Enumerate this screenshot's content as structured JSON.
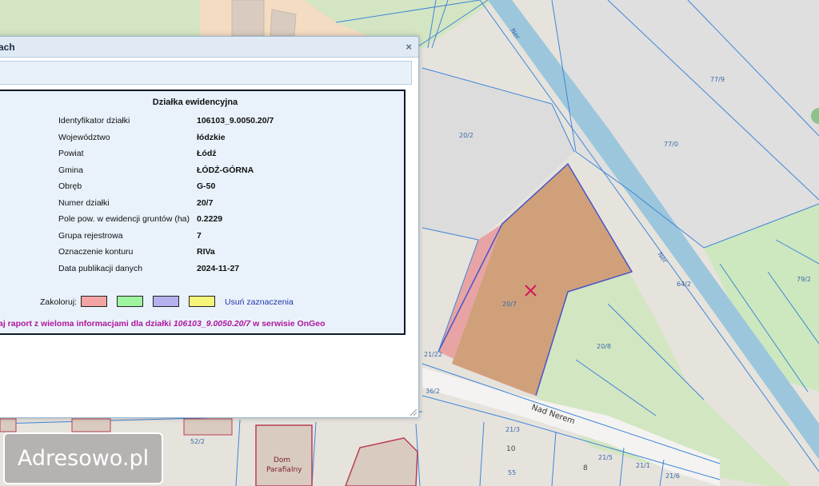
{
  "popup": {
    "title": "ach",
    "close_label": "×",
    "info": {
      "heading": "Działka ewidencyjna",
      "rows": [
        {
          "label": "Identyfikator działki",
          "value": "106103_9.0050.20/7"
        },
        {
          "label": "Województwo",
          "value": "łódzkie"
        },
        {
          "label": "Powiat",
          "value": "Łódź"
        },
        {
          "label": "Gmina",
          "value": "ŁÓDŹ-GÓRNA"
        },
        {
          "label": "Obręb",
          "value": "G-50"
        },
        {
          "label": "Numer działki",
          "value": "20/7"
        },
        {
          "label": "Pole pow. w ewidencji gruntów (ha)",
          "value": "0.2229"
        },
        {
          "label": "Grupa rejestrowa",
          "value": "7"
        },
        {
          "label": "Oznaczenie konturu",
          "value": "RIVa"
        },
        {
          "label": "Data publikacji danych",
          "value": "2024-11-27"
        }
      ],
      "colorize_label": "Zakoloruj:",
      "colors": [
        "#f4a3a3",
        "#9ff59f",
        "#b5b1ef",
        "#f5f57a"
      ],
      "clear_label": "Usuń zaznaczenia",
      "report_prefix": "aj raport z wieloma informacjami dla działki ",
      "report_parcel": "106103_9.0050.20/7",
      "report_suffix": " w serwisie OnGeo"
    }
  },
  "map": {
    "labels": {
      "river_1": "Ner",
      "river_2": "Ner",
      "street": "Nad Nerem",
      "building_name_1": "Dom",
      "building_name_2": "Parafialny",
      "parcel_20_7": "20/7",
      "parcel_20_2": "20/2",
      "parcel_20_8": "20/8",
      "parcel_77_9": "77/9",
      "parcel_77_0": "77/0",
      "parcel_79_2": "79/2",
      "parcel_64_2": "64/2",
      "parcel_21_22": "21/22",
      "parcel_36_2": "36/2",
      "parcel_52_2": "52/2",
      "parcel_21_3": "21/3",
      "parcel_21_5": "21/5",
      "parcel_21_1": "21/1",
      "parcel_21_6": "21/6",
      "house_10": "10",
      "house_8": "8",
      "house_55": "55"
    },
    "colors": {
      "parcel_fill": "#cfa07a",
      "pink_fill": "#e8a4a4",
      "green_fill": "#d3e6c2",
      "river": "#9cc6dc",
      "boundary": "#3f86d8",
      "marker": "#d2185e"
    }
  },
  "watermark": {
    "text": "Adresowo.pl"
  }
}
